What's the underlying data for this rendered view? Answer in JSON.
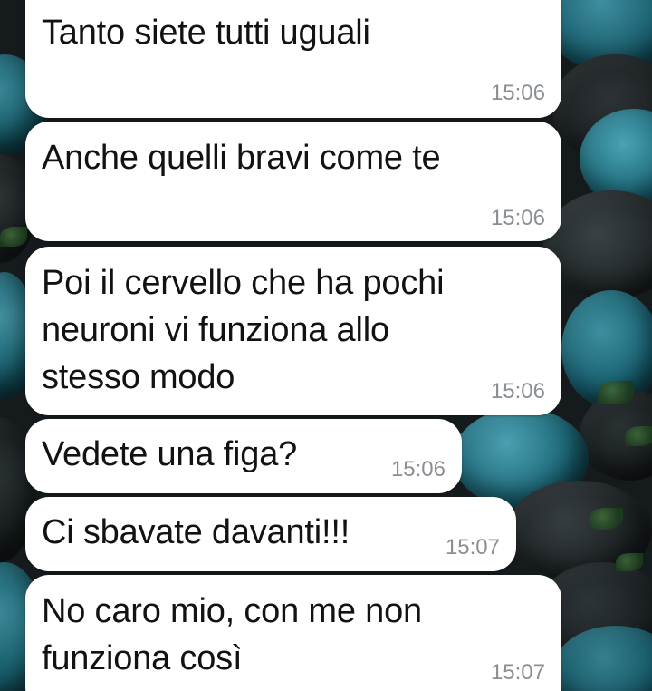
{
  "messages": [
    {
      "text": "Tanto siete tutti uguali",
      "time": "15:06"
    },
    {
      "text": "Anche quelli bravi come te",
      "time": "15:06"
    },
    {
      "text": "Poi il cervello che ha pochi\nneuroni vi funziona allo\nstesso modo",
      "time": "15:06"
    },
    {
      "text": "Vedete una figa?",
      "time": "15:06"
    },
    {
      "text": "Ci sbavate davanti!!!",
      "time": "15:07"
    },
    {
      "text": "No caro mio, con me non\nfunziona così",
      "time": "15:07"
    }
  ],
  "colors": {
    "bubble": "#ffffff",
    "text": "#121212",
    "timestamp": "#8a8f93",
    "wallpaper_dark": "#151a1c",
    "wallpaper_teal": "#1f6f7f"
  }
}
